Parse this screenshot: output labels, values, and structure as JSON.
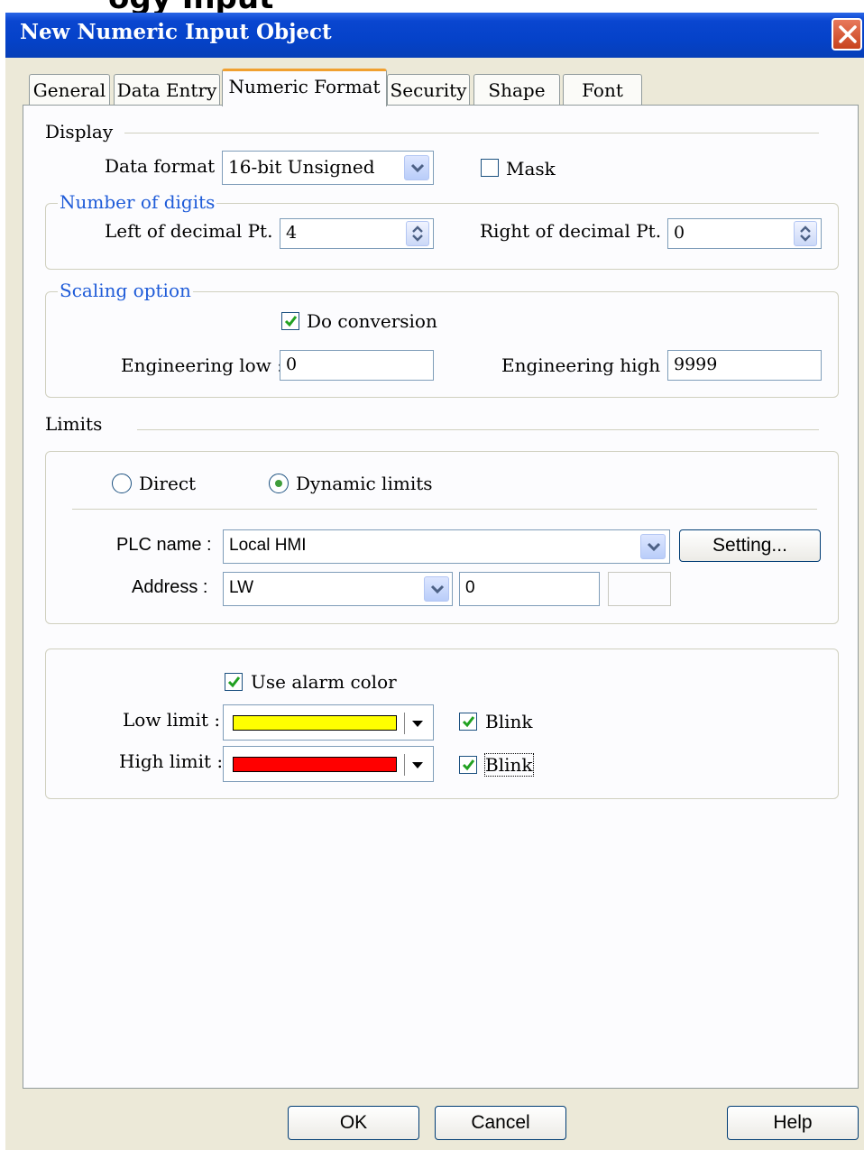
{
  "window": {
    "title": "New  Numeric Input Object",
    "clipped_header_text": "ogy Input"
  },
  "tabs": [
    "General",
    "Data Entry",
    "Numeric Format",
    "Security",
    "Shape",
    "Font"
  ],
  "display": {
    "heading": "Display",
    "data_format_label": "Data format :",
    "data_format_value": "16-bit Unsigned",
    "mask_label": "Mask",
    "mask_checked": false
  },
  "digits": {
    "legend": "Number of digits",
    "left_label": "Left of decimal Pt. :",
    "left_value": "4",
    "right_label": "Right of decimal Pt. :",
    "right_value": "0"
  },
  "scaling": {
    "legend": "Scaling option",
    "conversion_label": "Do conversion",
    "conversion_checked": true,
    "low_label": "Engineering low :",
    "low_value": "0",
    "high_label": "Engineering high :",
    "high_value": "9999"
  },
  "limits": {
    "heading": "Limits",
    "direct_label": "Direct",
    "dynamic_label": "Dynamic limits",
    "selected": "Dynamic limits",
    "plc_label": "PLC name :",
    "plc_value": "Local HMI",
    "setting_button": "Setting...",
    "address_label": "Address :",
    "address_type": "LW",
    "address_value": "0"
  },
  "alarm": {
    "use_color_label": "Use alarm color",
    "use_color_checked": true,
    "low_label": "Low limit :",
    "low_color": "#ffff00",
    "low_blink_label": "Blink",
    "low_blink": true,
    "high_label": "High limit :",
    "high_color": "#ff0000",
    "high_blink_label": "Blink",
    "high_blink": true
  },
  "buttons": {
    "ok": "OK",
    "cancel": "Cancel",
    "help": "Help"
  },
  "colors": {
    "title_bar": "#0542c9",
    "dialog_bg": "#ece9d8",
    "group_legend": "#1e5bd8",
    "active_tab_accent": "#f0a030"
  },
  "icons": [
    "close-icon",
    "dropdown-arrow-icon",
    "spin-arrows-icon",
    "checkmark-icon"
  ]
}
